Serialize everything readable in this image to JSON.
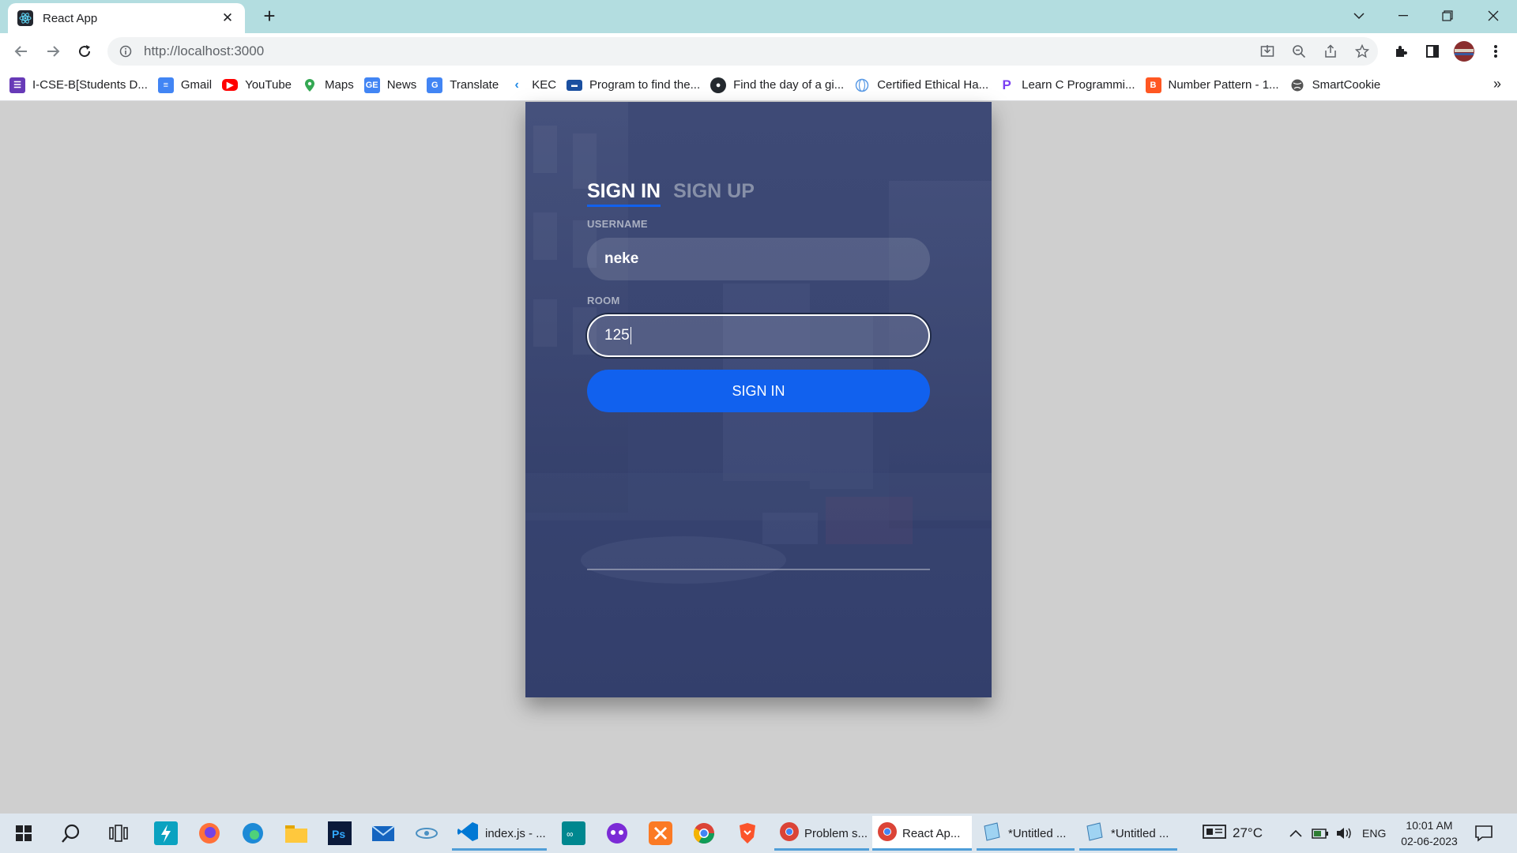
{
  "browser": {
    "tab_title": "React App",
    "url": "http://localhost:3000"
  },
  "bookmarks": [
    {
      "label": "I-CSE-B[Students D...",
      "icon": "forms-icon",
      "color": "#673ab7"
    },
    {
      "label": "Gmail",
      "icon": "docs-icon",
      "color": "#4285f4"
    },
    {
      "label": "YouTube",
      "icon": "youtube-icon",
      "color": "#ff0000"
    },
    {
      "label": "Maps",
      "icon": "maps-pin-icon",
      "color": "#34a853"
    },
    {
      "label": "News",
      "icon": "news-icon",
      "color": "#4285f4"
    },
    {
      "label": "Translate",
      "icon": "translate-icon",
      "color": "#4285f4"
    },
    {
      "label": "KEC",
      "icon": "kec-icon",
      "color": "#1e88e5"
    },
    {
      "label": "Program to find the...",
      "icon": "learning-icon",
      "color": "#1a4fa0"
    },
    {
      "label": "Find the day of a gi...",
      "icon": "github-icon",
      "color": "#24292e"
    },
    {
      "label": "Certified Ethical Ha...",
      "icon": "globe-icon",
      "color": "#5c9ce6"
    },
    {
      "label": "Learn C Programmi...",
      "icon": "programiz-icon",
      "color": "#7b3ff2"
    },
    {
      "label": "Number Pattern - 1...",
      "icon": "blogger-icon",
      "color": "#ff5722"
    },
    {
      "label": "SmartCookie",
      "icon": "globe-icon",
      "color": "#555555"
    }
  ],
  "login": {
    "tab_signin": "SIGN IN",
    "tab_signup": "SIGN UP",
    "username_label": "USERNAME",
    "username_value": "neke",
    "room_label": "ROOM",
    "room_value": "125",
    "submit_label": "SIGN IN"
  },
  "taskbar": {
    "apps": [
      {
        "label": "index.js - ...",
        "icon": "vscode-icon"
      },
      {
        "label": "Problem s...",
        "icon": "chrome-icon"
      },
      {
        "label": "React Ap...",
        "icon": "chrome-icon",
        "active": true
      },
      {
        "label": "*Untitled ...",
        "icon": "notepad-icon"
      },
      {
        "label": "*Untitled ...",
        "icon": "notepad-icon"
      }
    ],
    "temperature": "27°C",
    "language": "ENG",
    "time": "10:01 AM",
    "date": "02-06-2023"
  },
  "colors": {
    "accent": "#1161ee",
    "card": "#3a4672",
    "tabstrip": "#b3dde0"
  }
}
